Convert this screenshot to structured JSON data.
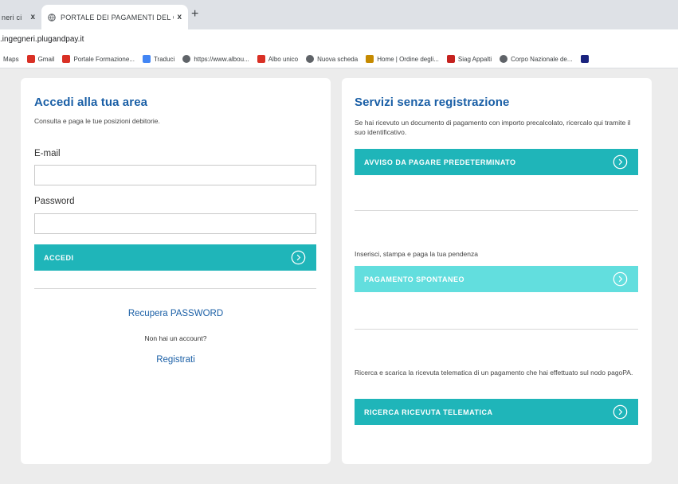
{
  "browser": {
    "prev_tab_title": "neri ci",
    "active_tab_title": "PORTALE DEI PAGAMENTI DEL C",
    "tab_close_glyph": "x",
    "new_tab_glyph": "+",
    "url": ".ingegneri.plugandpay.it"
  },
  "bookmarks": [
    {
      "label": "Maps",
      "icon": "maps-icon",
      "color": "#9aa0a6"
    },
    {
      "label": "Gmail",
      "icon": "gmail-icon",
      "color": "#d93025"
    },
    {
      "label": "Portale Formazione...",
      "icon": "formazione-icon",
      "color": "#d93025"
    },
    {
      "label": "Traduci",
      "icon": "translate-icon",
      "color": "#4285f4"
    },
    {
      "label": "https://www.albou...",
      "icon": "globe-icon",
      "color": "#5f6368"
    },
    {
      "label": "Albo unico",
      "icon": "albo-icon",
      "color": "#d93025"
    },
    {
      "label": "Nuova scheda",
      "icon": "globe-icon",
      "color": "#5f6368"
    },
    {
      "label": "Home | Ordine degli...",
      "icon": "ordine-icon",
      "color": "#c58a00"
    },
    {
      "label": "Siag Appalti",
      "icon": "siag-icon",
      "color": "#c5221f"
    },
    {
      "label": "Corpo Nazionale de...",
      "icon": "globe-icon",
      "color": "#5f6368"
    },
    {
      "label": "",
      "icon": "bookmark-app-icon",
      "color": "#1a237e"
    }
  ],
  "login": {
    "title": "Accedi alla tua area",
    "subtitle": "Consulta e paga le tue posizioni debitorie.",
    "email_label": "E-mail",
    "email_value": "",
    "password_label": "Password",
    "password_value": "",
    "submit_label": "ACCEDI",
    "recover_link": "Recupera PASSWORD",
    "no_account_text": "Non hai un account?",
    "register_link": "Registrati"
  },
  "services": {
    "title": "Servizi senza registrazione",
    "intro": "Se hai ricevuto un documento di pagamento con importo precalcolato, ricercalo qui tramite il suo identificativo.",
    "avviso_button": "AVVISO DA PAGARE PREDETERMINATO",
    "spontaneo_text": "Inserisci, stampa e paga la tua pendenza",
    "spontaneo_button": "PAGAMENTO SPONTANEO",
    "ricevuta_text": "Ricerca e scarica la ricevuta telematica di un pagamento che hai effettuato sul nodo pagoPA.",
    "ricevuta_button": "RICERCA RICEVUTA TELEMATICA"
  },
  "colors": {
    "accent": "#1fb5b9",
    "accent_light": "#62dede",
    "title_blue": "#1a5fa6"
  }
}
